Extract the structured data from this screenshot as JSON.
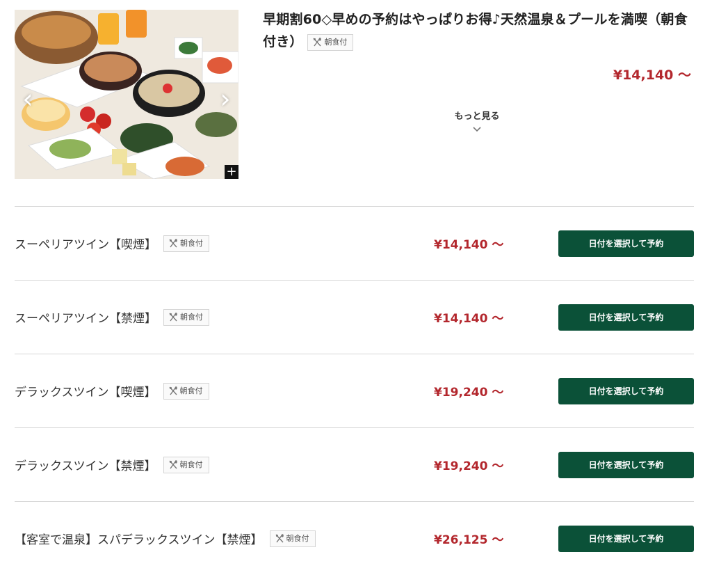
{
  "plan": {
    "title": "早期割60◇早めの予約はやっぱりお得♪天然温泉＆プールを満喫（朝食付き）",
    "meal_badge": "朝食付",
    "price": "¥14,140 ～",
    "more_label": "もっと見る",
    "photo_alt": "breakfast-buffet-photo"
  },
  "rooms": [
    {
      "name": "スーペリアツイン【喫煙】",
      "meal": "朝食付",
      "price": "¥14,140 ～",
      "button": "日付を選択して予約"
    },
    {
      "name": "スーペリアツイン【禁煙】",
      "meal": "朝食付",
      "price": "¥14,140 ～",
      "button": "日付を選択して予約"
    },
    {
      "name": "デラックスツイン【喫煙】",
      "meal": "朝食付",
      "price": "¥19,240 ～",
      "button": "日付を選択して予約"
    },
    {
      "name": "デラックスツイン【禁煙】",
      "meal": "朝食付",
      "price": "¥19,240 ～",
      "button": "日付を選択して予約"
    },
    {
      "name": "【客室で温泉】スパデラックスツイン【禁煙】",
      "meal": "朝食付",
      "price": "¥26,125 ～",
      "button": "日付を選択して予約"
    }
  ],
  "colors": {
    "price": "#b3272d",
    "button": "#0b5138"
  }
}
